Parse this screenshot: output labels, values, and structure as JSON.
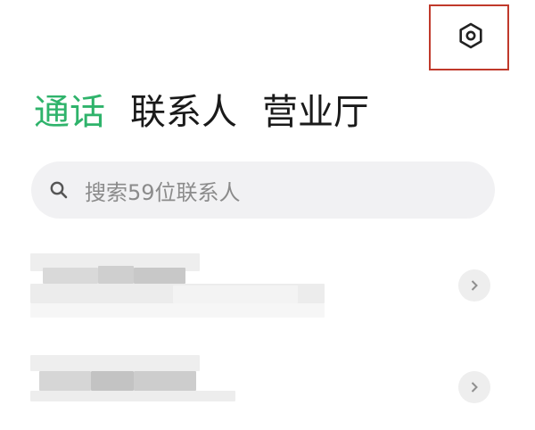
{
  "header": {
    "settings_icon": "gear-icon",
    "highlight_color": "#c0392b"
  },
  "tabs": [
    {
      "label": "通话",
      "active": true
    },
    {
      "label": "联系人",
      "active": false
    },
    {
      "label": "营业厅",
      "active": false
    }
  ],
  "search": {
    "icon": "search-icon",
    "placeholder": "搜索59位联系人"
  },
  "contacts": [
    {
      "name": "",
      "detail": "",
      "redacted": true,
      "chevron_icon": "chevron-right-icon"
    },
    {
      "name": "",
      "detail": "",
      "redacted": true,
      "chevron_icon": "chevron-right-icon"
    }
  ],
  "colors": {
    "accent": "#2fb36b",
    "text_primary": "#1a1a1a",
    "text_secondary": "#8b8b8b",
    "search_background": "#f1f1f3"
  }
}
